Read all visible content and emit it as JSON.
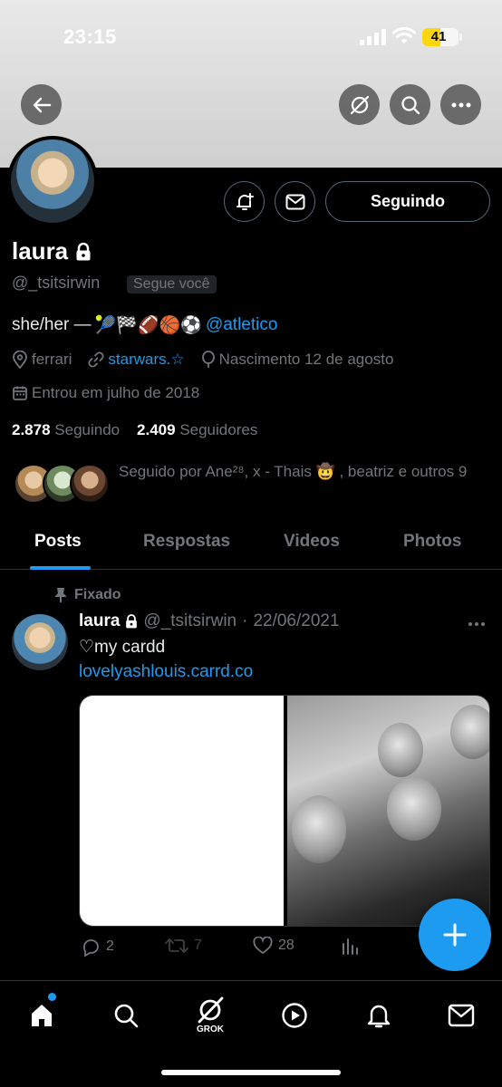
{
  "status_bar": {
    "time": "23:15",
    "battery": "41"
  },
  "header": {
    "back_icon": "arrow-left-icon",
    "grok_icon": "grok-icon",
    "search_icon": "search-icon",
    "more_icon": "more-horizontal-icon"
  },
  "profile": {
    "name": "laura",
    "handle": "@_tsitsirwin",
    "follows_you": "Segue você",
    "bio_text": "she/her —",
    "bio_emojis": "🎾🏁🏈🏀⚽",
    "bio_mention": "@atletico",
    "location": "ferrari",
    "website": "starwars.☆",
    "birthday": "Nascimento 12 de agosto",
    "joined": "Entrou em julho de 2018",
    "following_count": "2.878",
    "following_label": "Seguindo",
    "followers_count": "2.409",
    "followers_label": "Seguidores",
    "followed_by": "Seguido por Ane²⁸, x - Thais 🤠 , beatriz e outros 9",
    "following_button": "Seguindo"
  },
  "tabs": [
    {
      "label": "Posts",
      "active": true
    },
    {
      "label": "Respostas",
      "active": false
    },
    {
      "label": "Videos",
      "active": false
    },
    {
      "label": "Photos",
      "active": false
    }
  ],
  "post": {
    "pinned_label": "Fixado",
    "author_name": "laura",
    "author_handle": "@_tsitsirwin",
    "separator": "·",
    "date": "22/06/2021",
    "text": "♡my cardd",
    "link": "lovelyashlouis.carrd.co",
    "replies": "2",
    "reposts": "7",
    "likes": "28"
  },
  "bottom_nav": {
    "grok_label": "GROK",
    "items": [
      "home-icon",
      "search-icon",
      "grok-icon",
      "video-icon",
      "bell-icon",
      "mail-icon"
    ]
  },
  "colors": {
    "accent": "#1d9bf0",
    "text": "#e7e9ea",
    "muted": "#71767b",
    "border": "#2f3336",
    "battery": "#ffd60a"
  }
}
